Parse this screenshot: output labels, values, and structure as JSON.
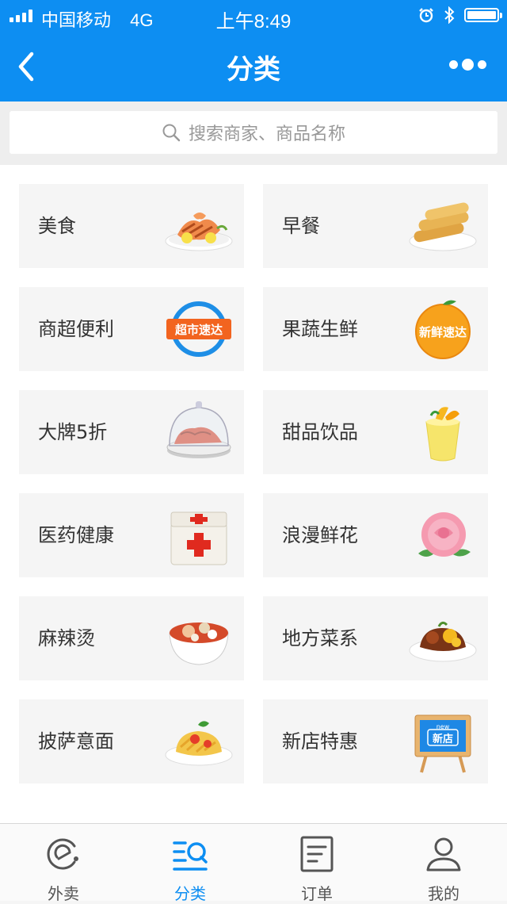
{
  "status_bar": {
    "carrier": "中国移动",
    "network": "4G",
    "time": "上午8:49"
  },
  "header": {
    "title": "分类"
  },
  "search": {
    "placeholder": "搜索商家、商品名称"
  },
  "categories": [
    {
      "label": "美食",
      "icon": "grilled-salmon-plate"
    },
    {
      "label": "早餐",
      "icon": "fried-dough-plate"
    },
    {
      "label": "商超便利",
      "icon": "supermarket-express-badge",
      "badge_text": "超市速达"
    },
    {
      "label": "果蔬生鲜",
      "icon": "fresh-express-orange",
      "badge_text": "新鲜速达"
    },
    {
      "label": "大牌5折",
      "icon": "lobster-cloche"
    },
    {
      "label": "甜品饮品",
      "icon": "mango-smoothie"
    },
    {
      "label": "医药健康",
      "icon": "first-aid-kit"
    },
    {
      "label": "浪漫鲜花",
      "icon": "pink-rose"
    },
    {
      "label": "麻辣烫",
      "icon": "spicy-hotpot-bowl"
    },
    {
      "label": "地方菜系",
      "icon": "local-dish-plate"
    },
    {
      "label": "披萨意面",
      "icon": "pasta-plate"
    },
    {
      "label": "新店特惠",
      "icon": "new-store-sign",
      "badge_top": "new",
      "badge_text": "新店"
    }
  ],
  "tabbar": [
    {
      "label": "外卖",
      "icon": "eleme-logo-icon",
      "active": false
    },
    {
      "label": "分类",
      "icon": "category-icon",
      "active": true
    },
    {
      "label": "订单",
      "icon": "order-list-icon",
      "active": false
    },
    {
      "label": "我的",
      "icon": "profile-icon",
      "active": false
    }
  ],
  "colors": {
    "brand": "#0d8ef2",
    "card_bg": "#f5f5f5",
    "text": "#333333"
  }
}
